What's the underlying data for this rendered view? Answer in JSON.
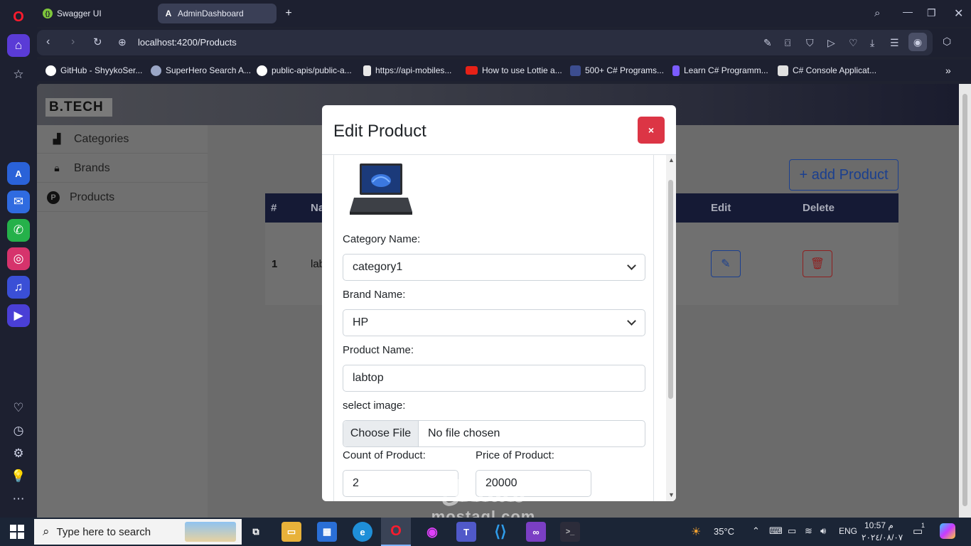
{
  "browser": {
    "tabs": [
      {
        "label": "Swagger UI",
        "icon": "swagger-icon"
      },
      {
        "label": "AdminDashboard",
        "icon": "angular-icon"
      }
    ],
    "url": "localhost:4200/Products",
    "bookmarks": [
      {
        "label": "GitHub - ShyykoSer...",
        "icon": "github-icon",
        "color": "#ffffff"
      },
      {
        "label": "SuperHero Search A...",
        "icon": "superhero-icon",
        "color": "#9aa6c6"
      },
      {
        "label": "public-apis/public-a...",
        "icon": "github-icon",
        "color": "#ffffff"
      },
      {
        "label": "https://api-mobiles...",
        "icon": "page-icon",
        "color": "#e8e8e8"
      },
      {
        "label": "How to use Lottie a...",
        "icon": "youtube-icon",
        "color": "#e62117"
      },
      {
        "label": "500+ C# Programs...",
        "icon": "csharp-icon",
        "color": "#3c4d8f"
      },
      {
        "label": "Learn C# Programm...",
        "icon": "learn-icon",
        "color": "#7b5cff"
      },
      {
        "label": "C# Console Applicat...",
        "icon": "csharp-console-icon",
        "color": "#e0e0e0"
      }
    ]
  },
  "app": {
    "logo": "B.TECH",
    "nav": [
      {
        "label": "Categories",
        "icon": "chart-icon"
      },
      {
        "label": "Brands",
        "icon": "lock-icon"
      },
      {
        "label": "Products",
        "icon": "product-p-icon"
      }
    ],
    "add_button": "+ add Product",
    "table": {
      "headers": [
        "#",
        "Na",
        "Edit",
        "Delete"
      ],
      "rows": [
        {
          "num": "1",
          "name": "lab"
        }
      ]
    }
  },
  "modal": {
    "title": "Edit Product",
    "close": "×",
    "category_label": "Category Name:",
    "category_value": "category1",
    "brand_label": "Brand Name:",
    "brand_value": "HP",
    "product_label": "Product Name:",
    "product_value": "labtop",
    "image_label": "select image:",
    "choose_file": "Choose File",
    "no_file": "No file chosen",
    "count_label": "Count of Product:",
    "count_value": "2",
    "price_label": "Price of Product:",
    "price_value": "20000"
  },
  "taskbar": {
    "search_placeholder": "Type here to search",
    "temperature": "35°C",
    "language": "ENG",
    "time": "10:57 م",
    "date": "٢٠٢٤/٠٨/٠٧",
    "notifications": "1"
  },
  "watermark": {
    "arabic": "مستقل",
    "latin": "mostaql.com"
  }
}
